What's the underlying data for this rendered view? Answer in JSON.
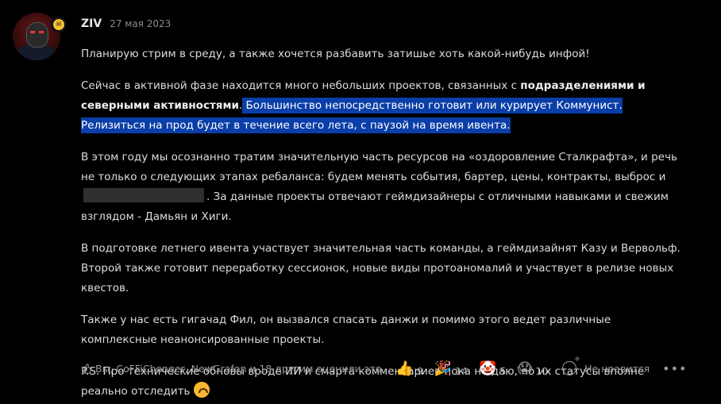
{
  "post": {
    "author": "ZIV",
    "date": "27 мая 2023",
    "badge_icon": "skull-icon",
    "paragraphs": {
      "p1": "Планирую стрим в среду, а также хочется разбавить затишье хоть какой-нибудь инфой!",
      "p2_a": "Сейчас в активной фазе находится много небольших проектов, связанных с ",
      "p2_bold": "подразделениями и северными активностями",
      "p2_dot": ".",
      "p2_highlight": " Большинство непосредственно готовит или курирует Коммунист. Релизиться на прод будет в течение всего лета, с паузой на время ивента.",
      "p3_a": "В этом году мы осознанно тратим значительную часть ресурсов на «оздоровление Сталкрафта», и речь не только о следующих этапах ребаланса: будем менять события, бартер, цены, контракты, выброс и",
      "p3_b": ". За данные проекты отвечают геймдизайнеры с отличными навыками и свежим взглядом - Дамьян и Хиги.",
      "p4": "В подготовке летнего ивента участвует значительная часть команды, а геймдизайнят Казу и Вервольф. Второй также готовит переработку сессионок, новые виды протоаномалий и участвует в релизе новых квестов.",
      "p5": "Также у нас есть гигачад Фил, он вызвался спасать данжи и помимо этого ведет различные комплексные неанонсированные проекты.",
      "p6": "P.S. Про технические обновы вроде ИИ и смарта комментариев пока не даю, но их статусы вполне реально отследить"
    }
  },
  "footer": {
    "liked_by": "Вы, CoFFiChonger, NewGrafon и 18 другим оценили это.",
    "reactions": [
      {
        "emoji": "👍",
        "count": "9",
        "icon": "thumbs-up-icon"
      },
      {
        "emoji": "🎉",
        "count": "14",
        "icon": "party-popper-icon"
      },
      {
        "emoji": "🤡",
        "count": "5",
        "icon": "clown-icon"
      },
      {
        "emoji": "😱",
        "count": "10",
        "icon": "screaming-face-icon"
      }
    ],
    "dislike_label": "Не нравится",
    "more_label": "•••"
  },
  "colors": {
    "background": "#000000",
    "highlight": "#0a3ea8",
    "text": "#dcdcdc",
    "muted": "#8a8a8a"
  }
}
